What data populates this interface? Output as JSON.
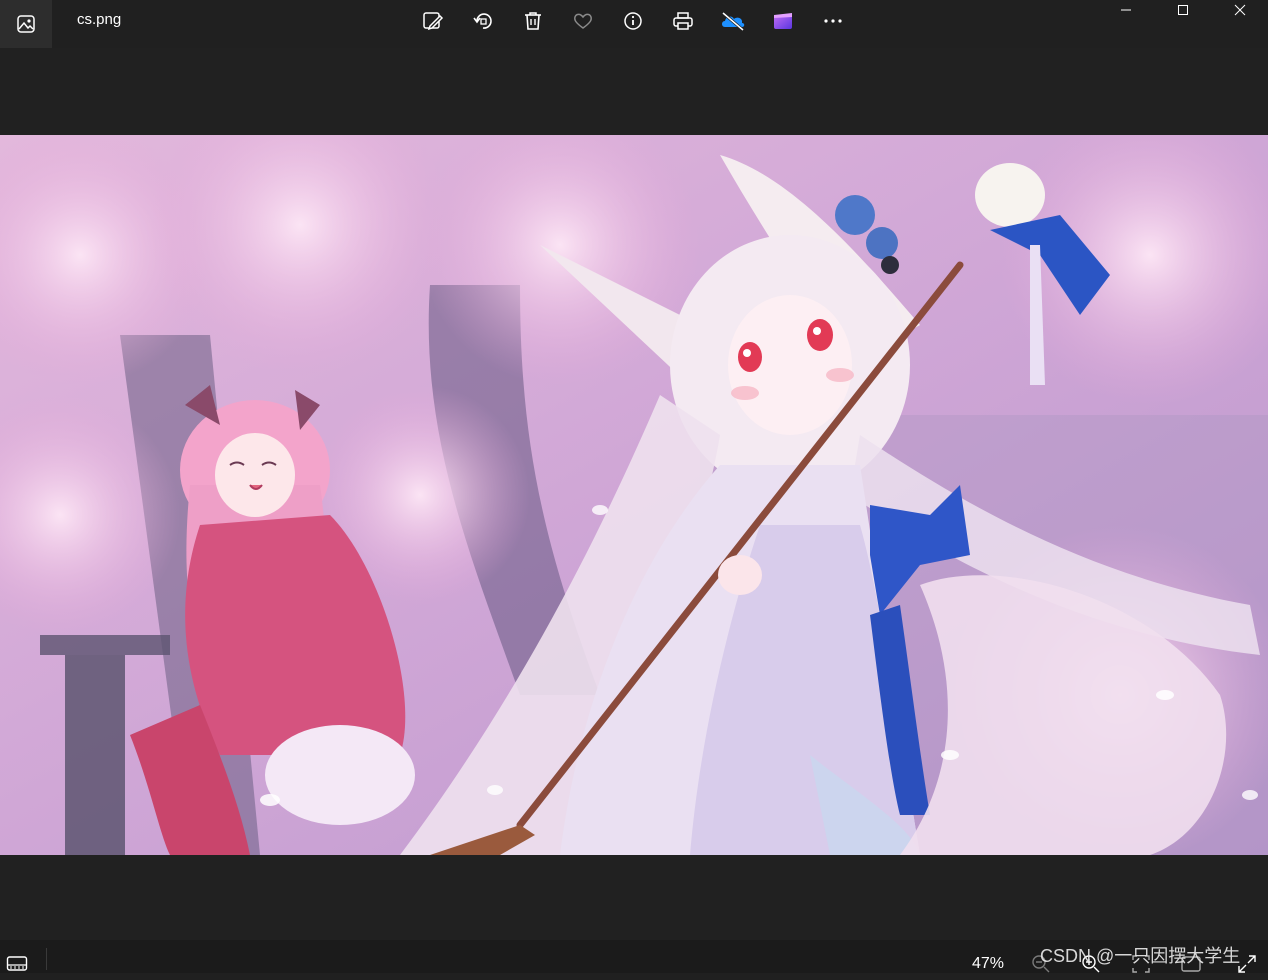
{
  "window": {
    "filename": "cs.png",
    "controls": [
      "minimize-icon",
      "maximize-icon",
      "close-icon"
    ]
  },
  "toolbar": {
    "icons": [
      "edit-image-icon",
      "rotate-icon",
      "delete-icon",
      "favorite-icon",
      "info-icon",
      "print-icon",
      "onedrive-off-icon",
      "clipchamp-icon",
      "more-icon"
    ]
  },
  "status": {
    "zoom": "47%",
    "watermark": "CSDN @一只因摆大学生"
  },
  "colors": {
    "chrome": "#202020",
    "onedrive": "#1e90ff",
    "clipchamp": "#7b4cf0"
  }
}
